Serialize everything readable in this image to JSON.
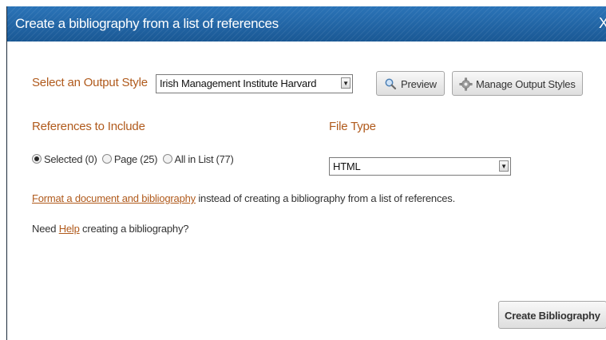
{
  "dialog": {
    "title": "Create a bibliography from a list of references",
    "close_label": "X"
  },
  "output_style": {
    "label": "Select an Output Style",
    "selected": "Irish Management Institute Harvard",
    "preview_label": "Preview",
    "manage_label": "Manage Output Styles"
  },
  "references": {
    "label": "References to Include",
    "options": [
      {
        "label": "Selected (0)",
        "checked": true
      },
      {
        "label": "Page (25)",
        "checked": false
      },
      {
        "label": "All in List (77)",
        "checked": false
      }
    ]
  },
  "file_type": {
    "label": "File Type",
    "selected": "HTML"
  },
  "format_line": {
    "link": "Format a document and bibliography",
    "rest": " instead of creating a bibliography from a list of references."
  },
  "help_line": {
    "prefix": "Need ",
    "link": "Help",
    "suffix": " creating a bibliography?"
  },
  "actions": {
    "create_label": "Create Bibliography"
  },
  "icons": {
    "preview": "magnifier-icon",
    "manage": "gear-icon",
    "dropdown": "chevron-down-icon"
  }
}
